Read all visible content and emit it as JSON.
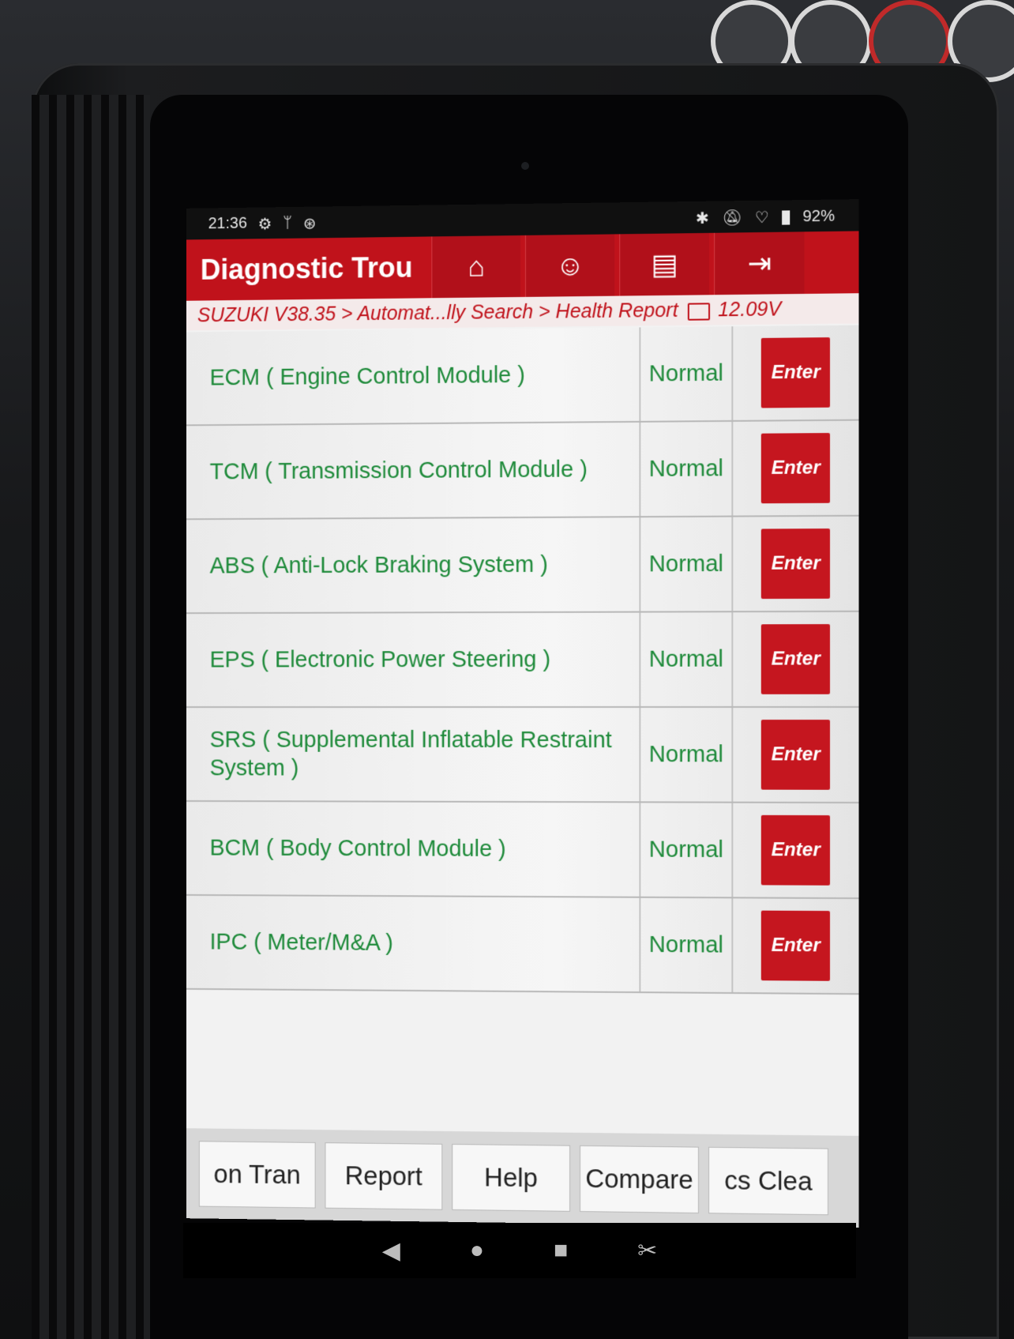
{
  "status_bar": {
    "time": "21:36",
    "icons_left": [
      "gear-icon",
      "usb-icon",
      "sync-icon"
    ],
    "icons_right": [
      "bluetooth-icon",
      "mute-icon",
      "wifi-icon"
    ],
    "battery": "92%"
  },
  "header": {
    "title": "Diagnostic Trou",
    "buttons": [
      "home-icon",
      "user-icon",
      "print-icon",
      "exit-icon"
    ]
  },
  "breadcrumb": {
    "path": "SUZUKI V38.35 > Automat...lly Search > Health Report",
    "voltage": "12.09V"
  },
  "rows": [
    {
      "name": "ECM ( Engine Control Module )",
      "status": "Normal",
      "action": "Enter"
    },
    {
      "name": "TCM ( Transmission Control Module )",
      "status": "Normal",
      "action": "Enter"
    },
    {
      "name": "ABS ( Anti-Lock Braking System )",
      "status": "Normal",
      "action": "Enter"
    },
    {
      "name": "EPS ( Electronic Power Steering )",
      "status": "Normal",
      "action": "Enter"
    },
    {
      "name": "SRS ( Supplemental Inflatable Restraint System )",
      "status": "Normal",
      "action": "Enter"
    },
    {
      "name": "BCM ( Body Control Module )",
      "status": "Normal",
      "action": "Enter"
    },
    {
      "name": "IPC ( Meter/M&A )",
      "status": "Normal",
      "action": "Enter"
    }
  ],
  "bottom_bar": {
    "buttons": [
      "on Tran",
      "Report",
      "Help",
      "Compare",
      "cs Clea"
    ]
  },
  "nav_bar": {
    "items": [
      "back-icon",
      "home-circle-icon",
      "recents-icon",
      "screenshot-icon"
    ],
    "glyphs": [
      "◀",
      "●",
      "■",
      "✂"
    ]
  },
  "colors": {
    "accent": "#c0121b",
    "ok_text": "#1e8a3a"
  }
}
